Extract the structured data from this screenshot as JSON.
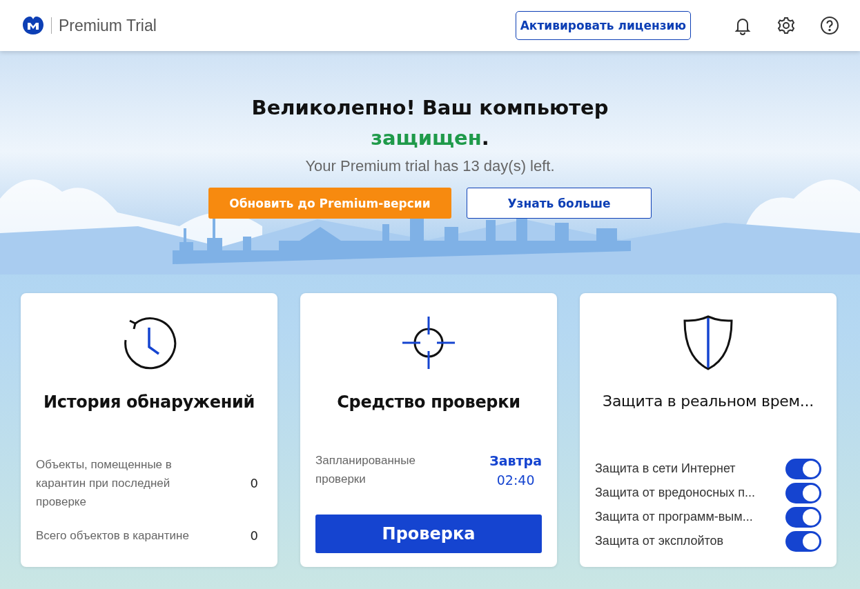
{
  "header": {
    "product": "Premium Trial",
    "activate_button": "Активировать лицензию"
  },
  "hero": {
    "title": "Великолепно! Ваш компьютер",
    "status": "защищен",
    "status_suffix": ".",
    "protected": true,
    "subtitle": "Your Premium trial has 13 day(s) left.",
    "buttons": [
      {
        "label": "Обновить до Premium-версии",
        "kind": "primary"
      },
      {
        "label": "Узнать больше",
        "kind": "outline"
      }
    ]
  },
  "cards": [
    {
      "kind": "history",
      "title": "История обнаружений",
      "stats": [
        {
          "label": "Объекты, помещенные в карантин при последней проверке",
          "value": "0"
        },
        {
          "label": "Всего объектов в карантине",
          "value": "0"
        }
      ]
    },
    {
      "kind": "scanner",
      "title": "Средство проверки",
      "scheduled_label": "Запланированные проверки",
      "scheduled_day": "Завтра",
      "scheduled_time": "02:40",
      "scan_button": "Проверка"
    },
    {
      "kind": "realtime",
      "title": "Защита в реальном врем...",
      "toggles": [
        {
          "label": "Защита в сети Интернет",
          "on": true
        },
        {
          "label": "Защита от вредоносных п...",
          "on": true
        },
        {
          "label": "Защита от программ-вым...",
          "on": true
        },
        {
          "label": "Защита от эксплойтов",
          "on": true
        }
      ]
    }
  ]
}
